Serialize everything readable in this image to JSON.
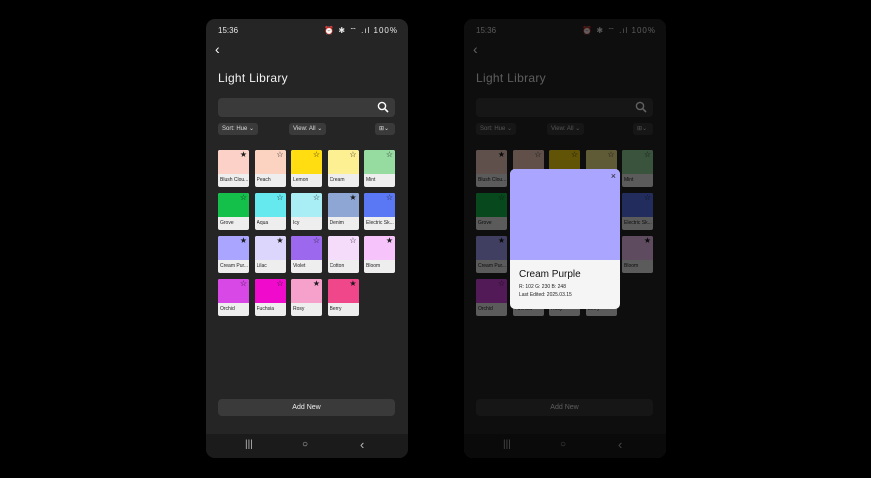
{
  "status": {
    "time": "15:36",
    "battery": "100%",
    "icons": "⏰ ✱ ⌔ .ıl"
  },
  "screen": {
    "title": "Light Library",
    "sort_label": "Sort: Hue ⌄",
    "view_label": "View: All ⌄",
    "grid_icon": "⊞⌄",
    "add_new": "Add New"
  },
  "colors": [
    {
      "name": "Blush Clou...",
      "hex": "#fcd2c8",
      "fav": true
    },
    {
      "name": "Peach",
      "hex": "#fcd3c1",
      "fav": false
    },
    {
      "name": "Lemon",
      "hex": "#ffdd11",
      "fav": false
    },
    {
      "name": "Cream",
      "hex": "#fdf092",
      "fav": false
    },
    {
      "name": "Mint",
      "hex": "#96dba0",
      "fav": false
    },
    {
      "name": "Grove",
      "hex": "#14c04a",
      "fav": false
    },
    {
      "name": "Aqua",
      "hex": "#65e8ee",
      "fav": false
    },
    {
      "name": "Icy",
      "hex": "#a8eef4",
      "fav": false
    },
    {
      "name": "Denim",
      "hex": "#8ea6d4",
      "fav": true
    },
    {
      "name": "Electric Sk...",
      "hex": "#5a78f4",
      "fav": false
    },
    {
      "name": "Cream Pur...",
      "hex": "#aaa6ff",
      "fav": true
    },
    {
      "name": "Lilac",
      "hex": "#dcd6fc",
      "fav": true
    },
    {
      "name": "Violet",
      "hex": "#9b68ee",
      "fav": false
    },
    {
      "name": "Cotton",
      "hex": "#f4dcfa",
      "fav": false
    },
    {
      "name": "Bloom",
      "hex": "#f6c4fa",
      "fav": true
    },
    {
      "name": "Orchid",
      "hex": "#d848e6",
      "fav": false
    },
    {
      "name": "Fuchsia",
      "hex": "#f00acc",
      "fav": false
    },
    {
      "name": "Rosy",
      "hex": "#f6a0cc",
      "fav": true
    },
    {
      "name": "Berry",
      "hex": "#f0468a",
      "fav": true
    }
  ],
  "modal": {
    "title": "Cream Purple",
    "rgb": "R: 102   G: 230   B: 248",
    "last_edited": "Last Edited: 2025.03.15",
    "swatch_hex": "#aaa6ff",
    "close": "×"
  },
  "navbar": {
    "recents": "|||",
    "home": "○",
    "back": "‹"
  }
}
